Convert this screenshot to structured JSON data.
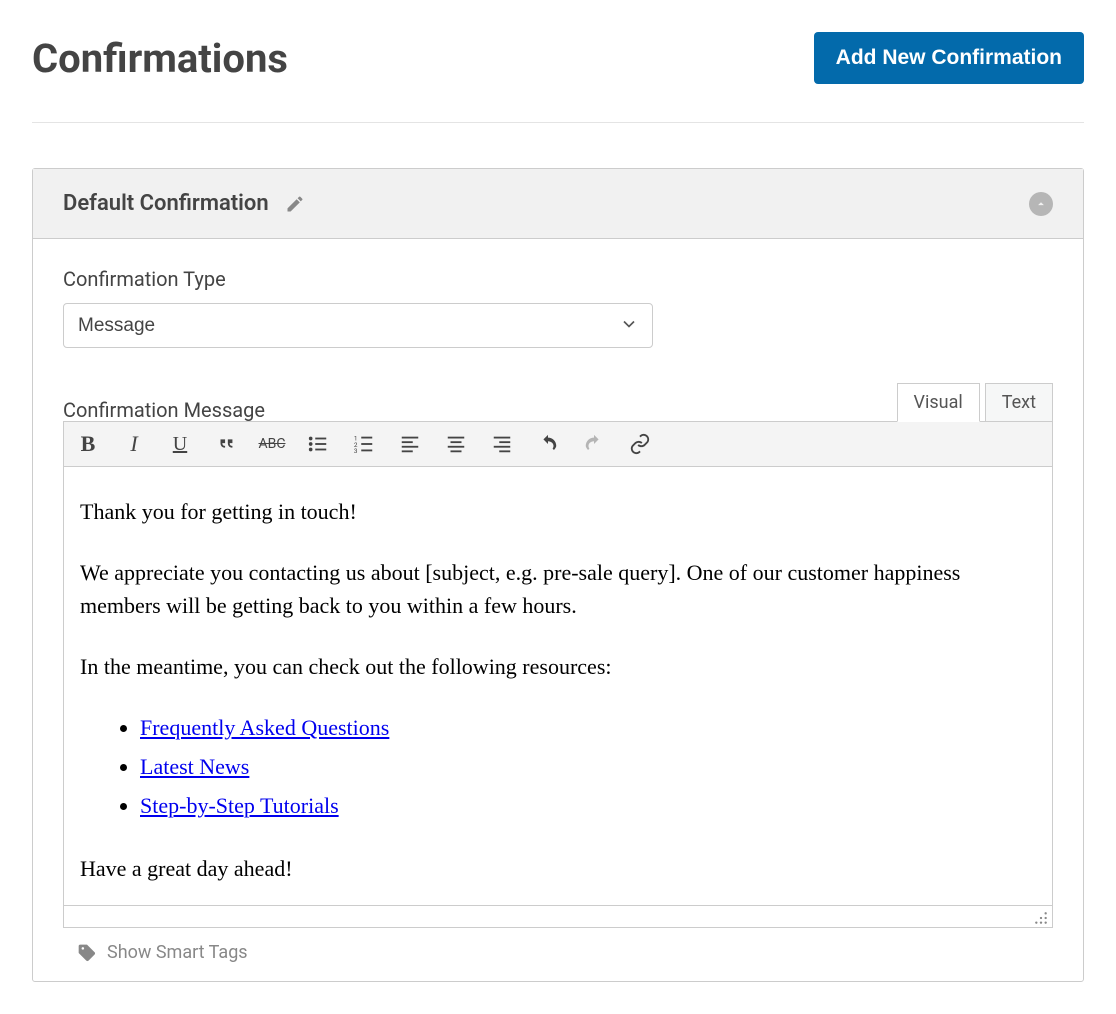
{
  "header": {
    "title": "Confirmations",
    "add_button": "Add New Confirmation"
  },
  "panel": {
    "title": "Default Confirmation"
  },
  "fields": {
    "confirmation_type_label": "Confirmation Type",
    "confirmation_type_value": "Message",
    "confirmation_message_label": "Confirmation Message"
  },
  "tabs": {
    "visual": "Visual",
    "text": "Text"
  },
  "editor_message": {
    "p1": "Thank you for getting in touch!",
    "p2": "We appreciate you contacting us about [subject, e.g. pre-sale query]. One of our customer happiness members will be getting back to you within a few hours.",
    "p3": "In the meantime, you can check out the following resources:",
    "links": [
      "Frequently Asked Questions",
      "Latest News",
      "Step-by-Step Tutorials"
    ],
    "p4": "Have a great day ahead!"
  },
  "footer": {
    "show_smart_tags": "Show Smart Tags"
  }
}
